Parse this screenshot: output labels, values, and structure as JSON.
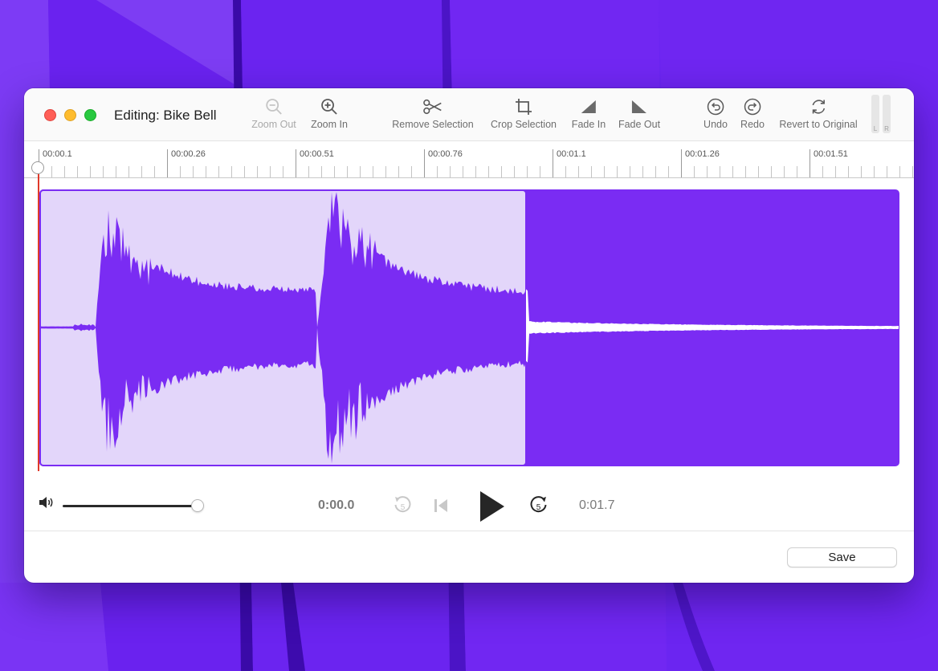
{
  "window": {
    "title": "Editing: Bike Bell"
  },
  "toolbar": {
    "zoom_out": {
      "label": "Zoom Out",
      "icon": "zoom-out-icon",
      "enabled": false
    },
    "zoom_in": {
      "label": "Zoom In",
      "icon": "zoom-in-icon",
      "enabled": true
    },
    "remove_selection": {
      "label": "Remove Selection",
      "icon": "scissors-icon"
    },
    "crop_selection": {
      "label": "Crop Selection",
      "icon": "crop-icon"
    },
    "fade_in": {
      "label": "Fade In",
      "icon": "fade-in-icon"
    },
    "fade_out": {
      "label": "Fade Out",
      "icon": "fade-out-icon"
    },
    "undo": {
      "label": "Undo",
      "icon": "undo-icon"
    },
    "redo": {
      "label": "Redo",
      "icon": "redo-icon"
    },
    "revert": {
      "label": "Revert to Original",
      "icon": "revert-icon"
    },
    "meters": {
      "left": "L",
      "right": "R"
    }
  },
  "timeline": {
    "labels": [
      "00:00.1",
      "00:00.26",
      "00:00.51",
      "00:00.76",
      "00:01.1",
      "00:01.26",
      "00:01.51"
    ]
  },
  "waveform": {
    "selection_fraction": 0.566,
    "colors": {
      "waveform": "#7a2cf3",
      "selection_bg": "#e3d6fa",
      "selection_border": "#7a2cf3",
      "unselected_bg": "#7a2cf3",
      "unselected_wave": "#ffffff",
      "playhead": "#e03a2a"
    }
  },
  "transport": {
    "current_time": "0:00.0",
    "total_time": "0:01.7",
    "volume_fraction": 1.0,
    "skip_back_seconds": "5",
    "skip_forward_seconds": "5"
  },
  "footer": {
    "save_label": "Save"
  },
  "colors": {
    "wallpaper": "#6a24f0",
    "accent": "#7a2cf3"
  }
}
